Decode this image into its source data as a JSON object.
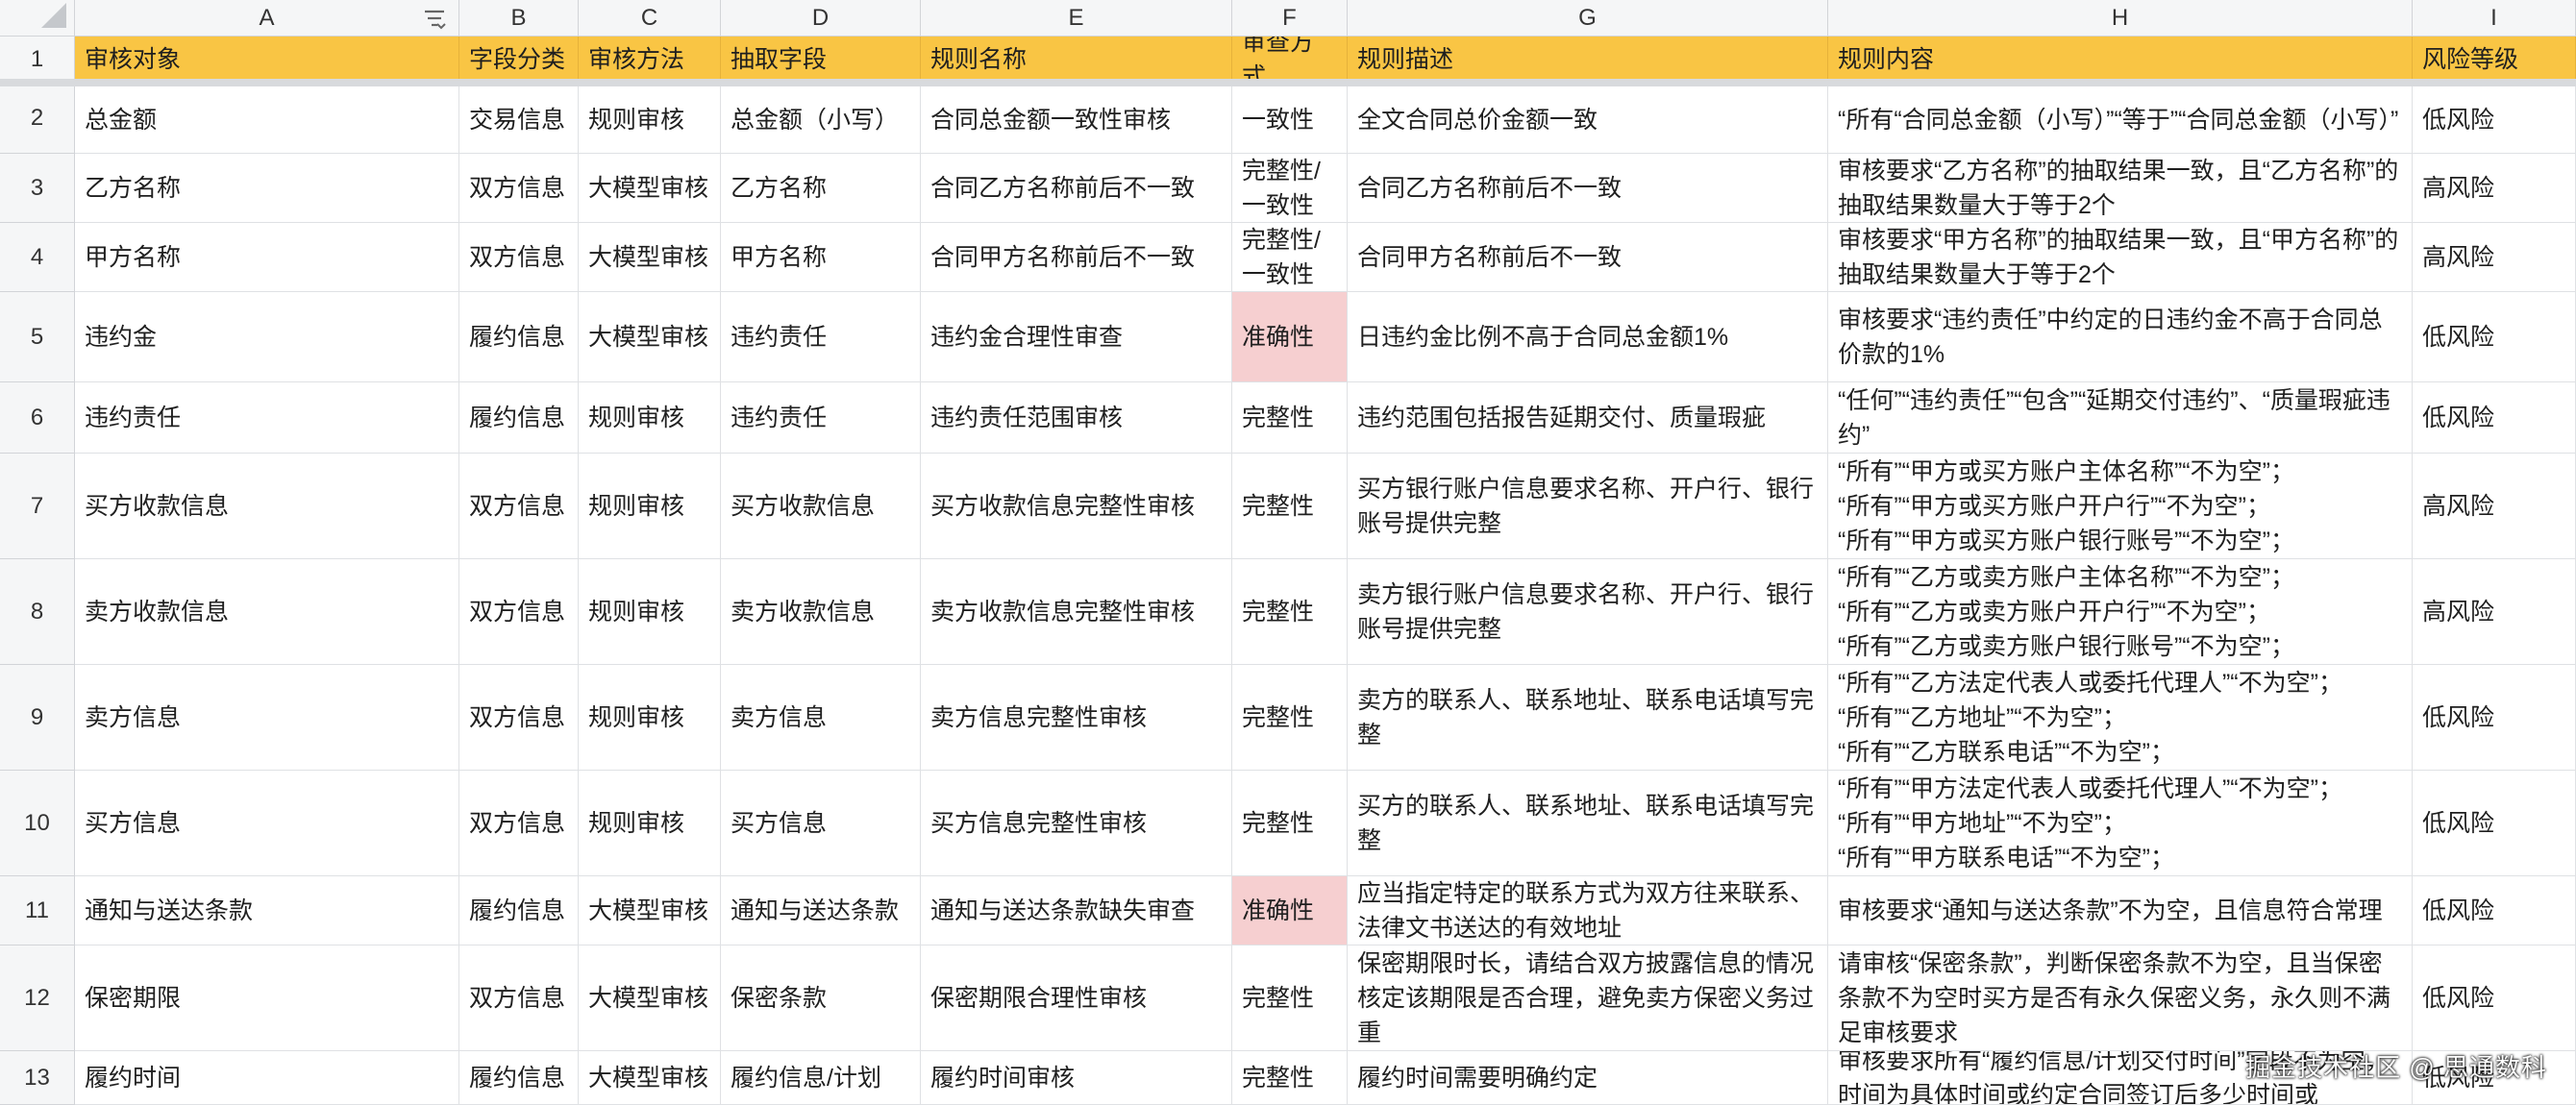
{
  "colors": {
    "header_row_bg": "#f9c544",
    "highlight_bg": "#f6cfd0",
    "gridline": "#dfe1e4",
    "col_header_bg": "#f5f6f7"
  },
  "columns": [
    "A",
    "B",
    "C",
    "D",
    "E",
    "F",
    "G",
    "H",
    "I"
  ],
  "row_numbers": [
    "1",
    "2",
    "3",
    "4",
    "5",
    "6",
    "7",
    "8",
    "9",
    "10",
    "11",
    "12",
    "13"
  ],
  "header_row": [
    "审核对象",
    "字段分类",
    "审核方法",
    "抽取字段",
    "规则名称",
    "审查方式",
    "规则描述",
    "规则内容",
    "风险等级"
  ],
  "rows": [
    {
      "cells": [
        "总金额",
        "交易信息",
        "规则审核",
        "总金额（小写）",
        "合同总金额一致性审核",
        "一致性",
        "全文合同总价金额一致",
        "“所有“合同总金额（小写）”“等于”“合同总金额（小写）”",
        "低风险"
      ]
    },
    {
      "cells": [
        "乙方名称",
        "双方信息",
        "大模型审核",
        "乙方名称",
        "合同乙方名称前后不一致",
        "完整性/\n一致性",
        "合同乙方名称前后不一致",
        "审核要求“乙方名称”的抽取结果一致，且“乙方名称”的抽取结果数量大于等于2个",
        "高风险"
      ]
    },
    {
      "cells": [
        "甲方名称",
        "双方信息",
        "大模型审核",
        "甲方名称",
        "合同甲方名称前后不一致",
        "完整性/\n一致性",
        "合同甲方名称前后不一致",
        "审核要求“甲方名称”的抽取结果一致，且“甲方名称”的抽取结果数量大于等于2个",
        "高风险"
      ]
    },
    {
      "cells": [
        "违约金",
        "履约信息",
        "大模型审核",
        "违约责任",
        "违约金合理性审查",
        "准确性",
        "日违约金比例不高于合同总金额1%",
        "审核要求“违约责任”中约定的日违约金不高于合同总价款的1%",
        "低风险"
      ],
      "highlight": true
    },
    {
      "cells": [
        "违约责任",
        "履约信息",
        "规则审核",
        "违约责任",
        "违约责任范围审核",
        "完整性",
        "违约范围包括报告延期交付、质量瑕疵",
        "“任何”“违约责任”“包含”“延期交付违约”、“质量瑕疵违约”",
        "低风险"
      ]
    },
    {
      "cells": [
        "买方收款信息",
        "双方信息",
        "规则审核",
        "买方收款信息",
        "买方收款信息完整性审核",
        "完整性",
        "买方银行账户信息要求名称、开户行、银行账号提供完整",
        "“所有”“甲方或买方账户主体名称”“不为空”；\n“所有”“甲方或买方账户开户行”“不为空”；\n“所有”“甲方或买方账户银行账号”“不为空”；",
        "高风险"
      ]
    },
    {
      "cells": [
        "卖方收款信息",
        "双方信息",
        "规则审核",
        "卖方收款信息",
        "卖方收款信息完整性审核",
        "完整性",
        "卖方银行账户信息要求名称、开户行、银行账号提供完整",
        "“所有”“乙方或卖方账户主体名称”“不为空”；\n“所有”“乙方或卖方账户开户行”“不为空”；\n“所有”“乙方或卖方账户银行账号”“不为空”；",
        "高风险"
      ]
    },
    {
      "cells": [
        "卖方信息",
        "双方信息",
        "规则审核",
        "卖方信息",
        "卖方信息完整性审核",
        "完整性",
        "卖方的联系人、联系地址、联系电话填写完整",
        "“所有”“乙方法定代表人或委托代理人”“不为空”；\n“所有”“乙方地址”“不为空”；\n“所有”“乙方联系电话”“不为空”；",
        "低风险"
      ]
    },
    {
      "cells": [
        "买方信息",
        "双方信息",
        "规则审核",
        "买方信息",
        "买方信息完整性审核",
        "完整性",
        "买方的联系人、联系地址、联系电话填写完整",
        "“所有”“甲方法定代表人或委托代理人”“不为空”；\n“所有”“甲方地址”“不为空”；\n“所有”“甲方联系电话”“不为空”；",
        "低风险"
      ]
    },
    {
      "cells": [
        "通知与送达条款",
        "履约信息",
        "大模型审核",
        "通知与送达条款",
        "通知与送达条款缺失审查",
        "准确性",
        "应当指定特定的联系方式为双方往来联系、法律文书送达的有效地址",
        "审核要求“通知与送达条款”不为空，且信息符合常理",
        "低风险"
      ],
      "highlight": true
    },
    {
      "cells": [
        "保密期限",
        "双方信息",
        "大模型审核",
        "保密条款",
        "保密期限合理性审核",
        "完整性",
        "保密期限时长，请结合双方披露信息的情况核定该期限是否合理，避免卖方保密义务过重",
        "请审核“保密条款”，判断保密条款不为空，且当保密条款不为空时买方是否有永久保密义务，永久则不满足审核要求",
        "低风险"
      ]
    },
    {
      "cells": [
        "履约时间",
        "履约信息",
        "大模型审核",
        "履约信息/计划",
        "履约时间审核",
        "完整性",
        "履约时间需要明确约定",
        "审核要求所有“履约信息/计划交付时间”字段不为空，时间为具体时间或约定合同签订后多少时间或",
        "低风险"
      ]
    }
  ],
  "watermark": "掘金技术社区 @ 思通数科"
}
